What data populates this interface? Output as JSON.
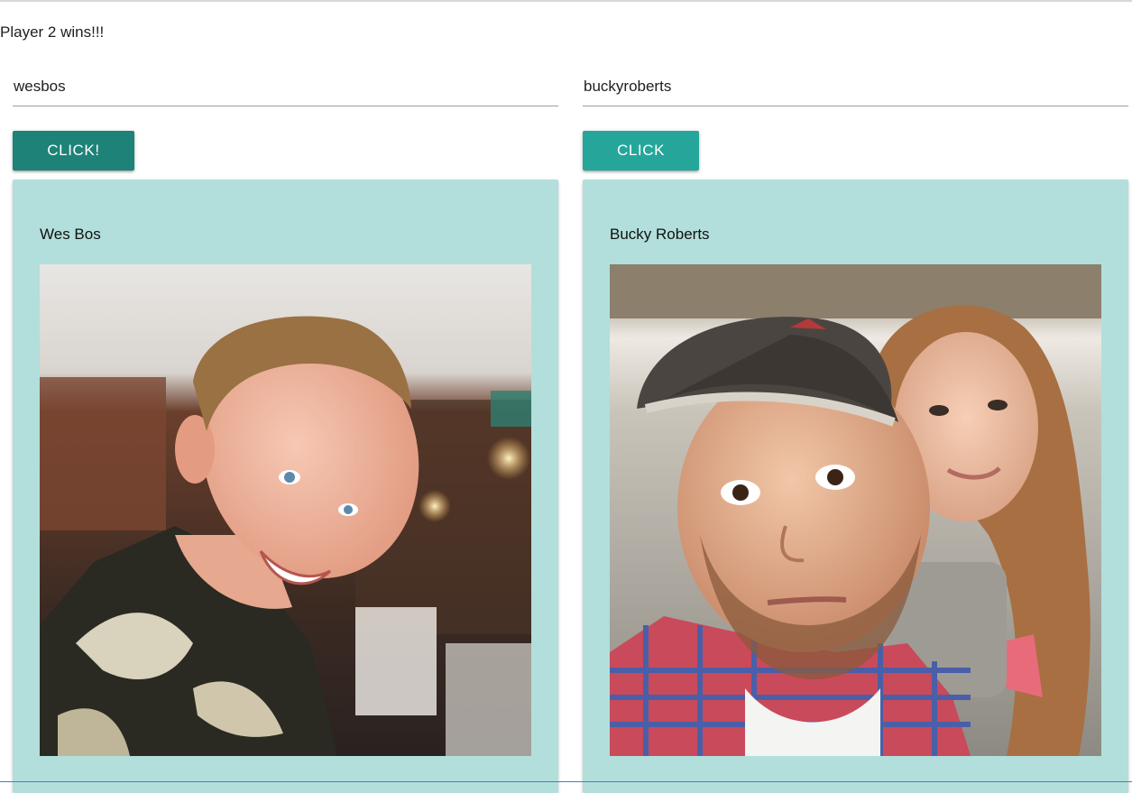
{
  "result": {
    "text": "Player 2 wins!!!"
  },
  "players": [
    {
      "username_value": "wesbos",
      "button_label": "CLICK!",
      "card_name": "Wes Bos"
    },
    {
      "username_value": "buckyroberts",
      "button_label": "CLICK",
      "card_name": "Bucky Roberts"
    }
  ],
  "colors": {
    "button_dark": "#1e8278",
    "button_light": "#26a69a",
    "card_background": "#b2dfdb"
  }
}
